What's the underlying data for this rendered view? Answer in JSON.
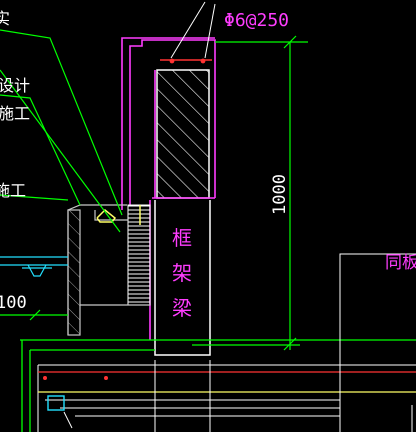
{
  "labels": {
    "rebar_spec": "Φ6@250",
    "beam_label": [
      "框",
      "架",
      "梁"
    ],
    "dimension_vertical": "1000",
    "dimension_left": "100",
    "left_fragments": [
      "实",
      "设计",
      "施工",
      "施工"
    ],
    "right_fragment": "同板钢"
  },
  "colors": {
    "background": "#000000",
    "magenta": "#ff3dff",
    "green": "#00ff00",
    "white": "#ffffff",
    "red": "#ff3333",
    "yellow": "#ffff66",
    "cyan": "#22e0ff",
    "grey": "#c8c8c8"
  }
}
